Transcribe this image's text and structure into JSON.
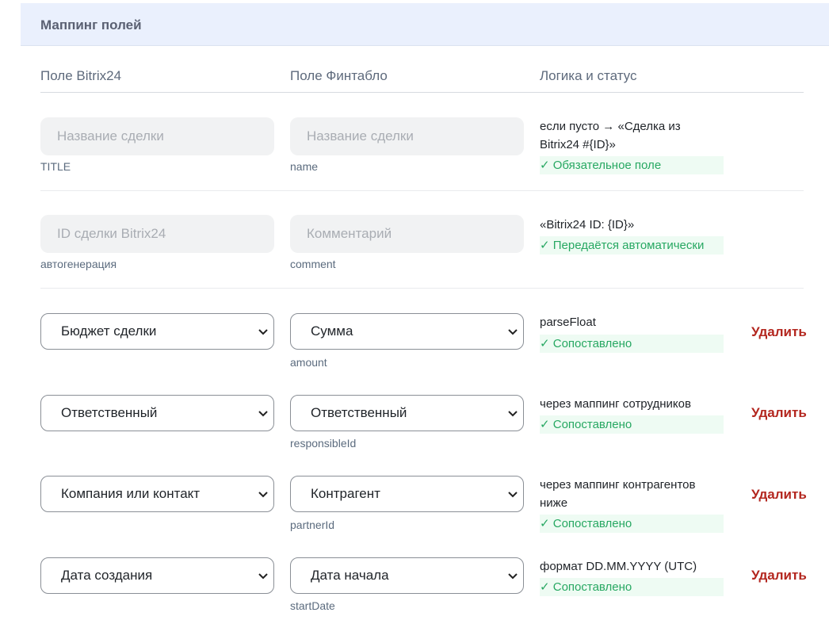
{
  "header": {
    "title": "Маппинг полей"
  },
  "columns": {
    "bitrix": "Поле Bitrix24",
    "fintablo": "Поле Финтабло",
    "logic": "Логика и статус"
  },
  "rows": [
    {
      "bitrix_placeholder": "Название сделки",
      "bitrix_sub": "TITLE",
      "fintablo_placeholder": "Название сделки",
      "fintablo_sub": "name",
      "logic_line1": "если пусто → «Сделка из",
      "logic_line2": "Bitrix24 #{ID}»",
      "status": "✓ Обязательное поле"
    },
    {
      "bitrix_placeholder": "ID сделки Bitrix24",
      "bitrix_sub": "автогенерация",
      "fintablo_placeholder": "Комментарий",
      "fintablo_sub": "comment",
      "logic_line1": "«Bitrix24 ID: {ID}»",
      "status": "✓ Передаётся автоматически"
    },
    {
      "bitrix_value": "Бюджет сделки",
      "fintablo_value": "Сумма",
      "fintablo_sub": "amount",
      "logic_line1": "parseFloat",
      "status": "✓ Сопоставлено",
      "delete_label": "Удалить"
    },
    {
      "bitrix_value": "Ответственный",
      "fintablo_value": "Ответственный",
      "fintablo_sub": "responsibleId",
      "logic_line1": "через маппинг сотрудников",
      "status": "✓ Сопоставлено",
      "delete_label": "Удалить"
    },
    {
      "bitrix_value": "Компания или контакт",
      "fintablo_value": "Контрагент",
      "fintablo_sub": "partnerId",
      "logic_line1": "через маппинг контрагентов",
      "logic_line2": "ниже",
      "status": "✓ Сопоставлено",
      "delete_label": "Удалить"
    },
    {
      "bitrix_value": "Дата создания",
      "fintablo_value": "Дата начала",
      "fintablo_sub": "startDate",
      "logic_line1": "формат DD.MM.YYYY (UTC)",
      "status": "✓ Сопоставлено",
      "delete_label": "Удалить"
    }
  ],
  "icons": {
    "select_chevron": "chevron-down-icon"
  },
  "colors": {
    "header_bg": "#eaf0fd",
    "status_green": "#27a862",
    "status_bg": "#eefbf3",
    "delete_red": "#b3261e"
  }
}
